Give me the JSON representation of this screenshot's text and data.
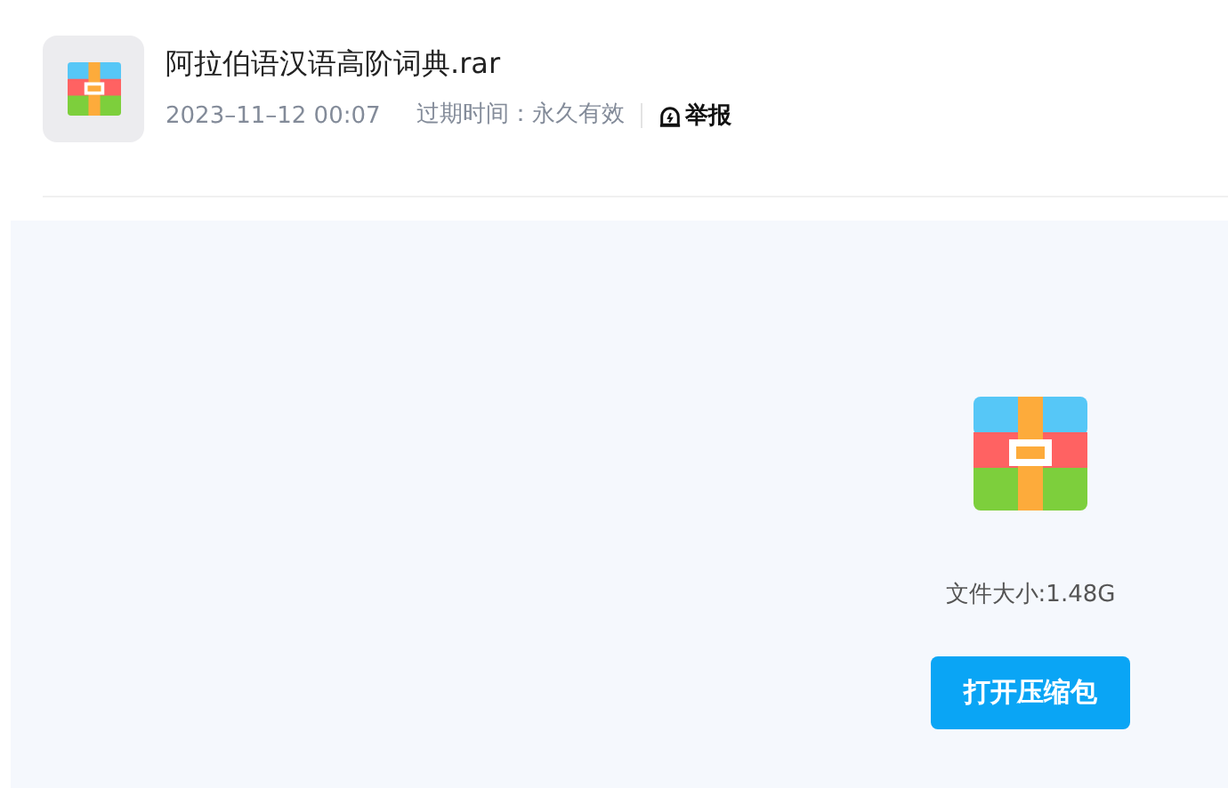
{
  "file": {
    "name": "阿拉伯语汉语高阶词典.rar",
    "date": "2023–11–12 00:07",
    "expiry_label": "过期时间：",
    "expiry_value": "永久有效",
    "report": "举报"
  },
  "preview": {
    "size": "文件大小:1.48G",
    "open_button": "打开压缩包"
  }
}
